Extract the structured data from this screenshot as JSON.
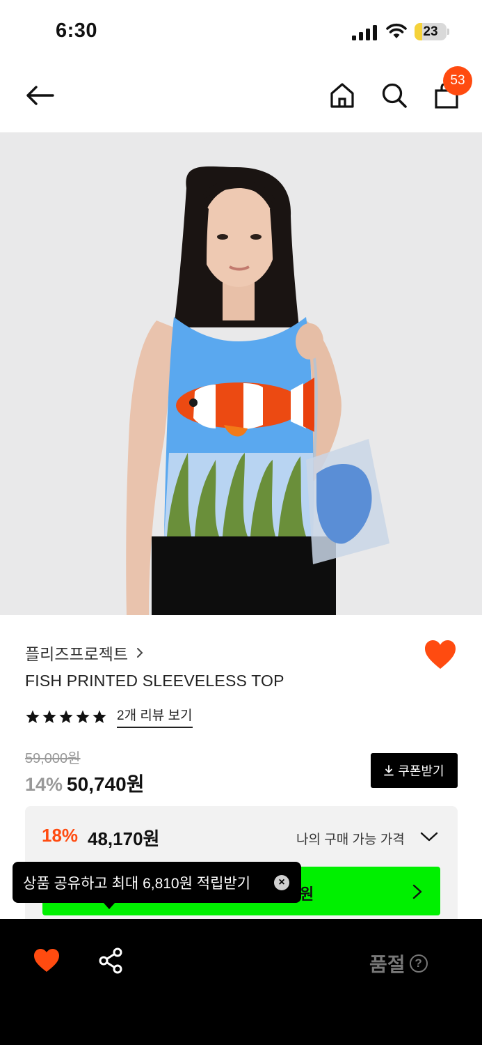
{
  "status_bar": {
    "time": "6:30",
    "battery": "23",
    "battery_level": 0.23
  },
  "nav": {
    "cart_count": "53"
  },
  "product": {
    "brand": "플리즈프로젝트",
    "name": "FISH PRINTED SLEEVELESS TOP",
    "rating_stars": 5,
    "review_link": "2개 리뷰 보기",
    "original_price": "59,000원",
    "discount_rate": "14%",
    "sale_price": "50,740원",
    "coupon_label": "쿠폰받기"
  },
  "my_price": {
    "rate": "18%",
    "value": "48,170원",
    "label": "나의 구매 가능 가격"
  },
  "green_banner": {
    "text_suffix": "원"
  },
  "tooltip": {
    "text": "상품 공유하고 최대 6,810원 적립받기",
    "close": "×"
  },
  "bottom_bar": {
    "soldout_label": "품절",
    "help": "?"
  },
  "colors": {
    "accent": "#ff4b10",
    "banner_green": "#00f000",
    "dark": "#000000"
  },
  "icons": [
    "back-arrow-icon",
    "home-icon",
    "search-icon",
    "shopping-bag-icon",
    "chevron-right-icon",
    "heart-icon",
    "star-icon",
    "download-icon",
    "chevron-down-icon",
    "close-icon",
    "share-icon",
    "question-icon"
  ]
}
